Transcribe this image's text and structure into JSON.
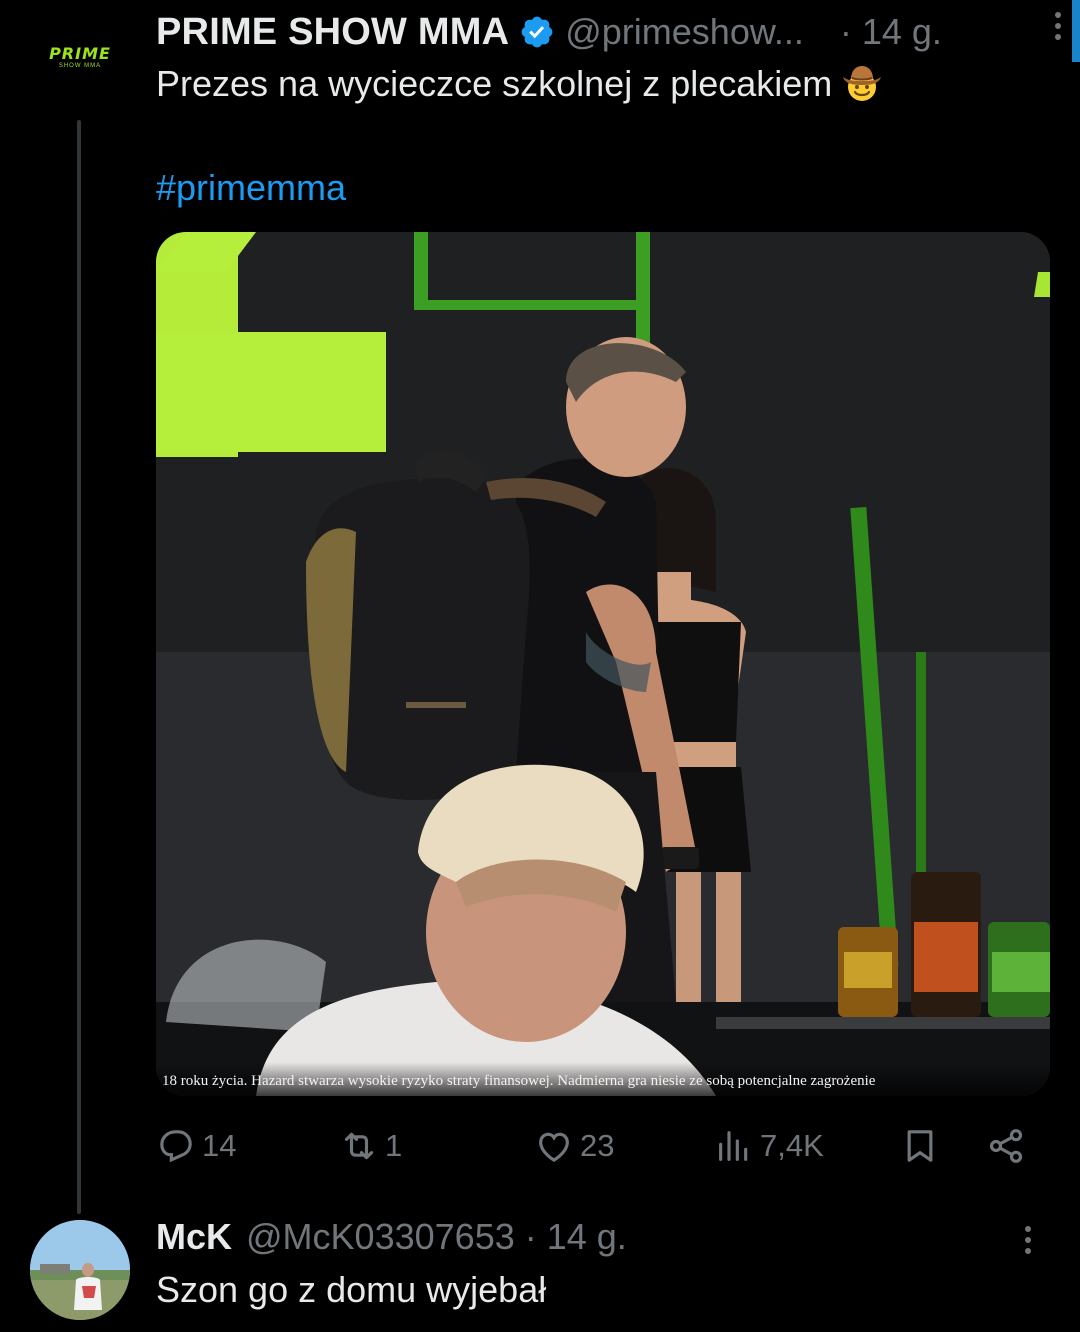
{
  "post": {
    "display_name": "PRIME SHOW MMA",
    "verified": true,
    "handle": "@primeshow...",
    "time": "· 14 g.",
    "text": "Prezes na wycieczce szkolnej z plecakiem",
    "emoji": "cowboy-hat-face",
    "hashtag": "#primemma",
    "avatar": {
      "logo_text": "PRIME",
      "logo_sub": "SHOW MMA",
      "color": "#9be31c"
    },
    "media": {
      "caption": "18 roku życia. Hazard stwarza wysokie ryzyko straty finansowej. Nadmierna gra niesie ze sobą potencjalne zagrożenie"
    },
    "actions": {
      "replies": "14",
      "reposts": "1",
      "likes": "23",
      "views": "7,4K"
    }
  },
  "reply": {
    "display_name": "McK",
    "handle": "@McK03307653 · 14 g.",
    "text": "Szon go z domu wyjebał"
  },
  "colors": {
    "background": "#000000",
    "text": "#e7e9ea",
    "secondary": "#71767b",
    "accent": "#1d9bf0",
    "brand_green": "#9be31c"
  }
}
